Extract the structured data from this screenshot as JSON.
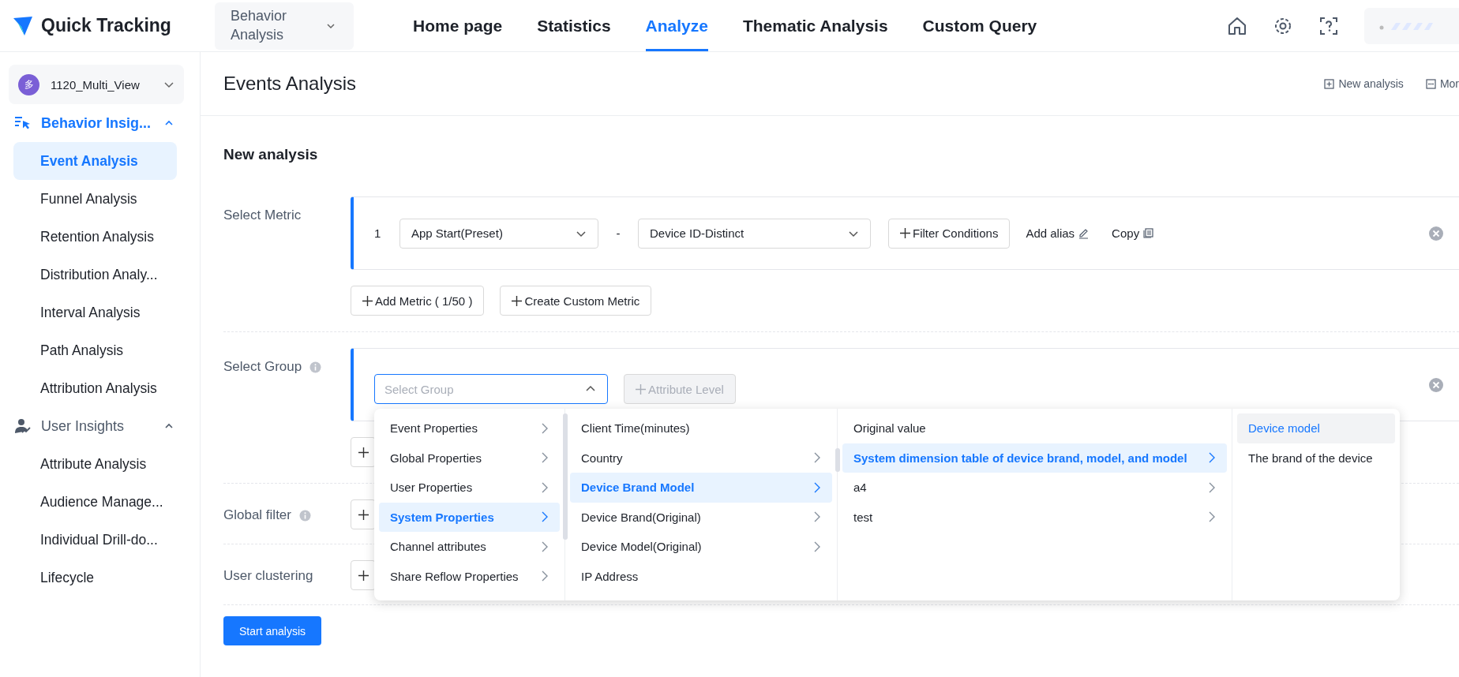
{
  "header": {
    "logo_text": "Quick Tracking",
    "product_select": "Behavior Analysis",
    "nav": [
      {
        "label": "Home page",
        "selected": false
      },
      {
        "label": "Statistics",
        "selected": false
      },
      {
        "label": "Analyze",
        "selected": true
      },
      {
        "label": "Thematic Analysis",
        "selected": false
      },
      {
        "label": "Custom Query",
        "selected": false
      }
    ]
  },
  "sidebar": {
    "workspace": {
      "avatar": "多",
      "name": "1120_Multi_View"
    },
    "groups": [
      {
        "label": "Behavior Insig...",
        "kind": "behavior",
        "selected": true,
        "expanded": true,
        "items": [
          {
            "label": "Event Analysis",
            "selected": true
          },
          {
            "label": "Funnel Analysis",
            "selected": false
          },
          {
            "label": "Retention Analysis",
            "selected": false
          },
          {
            "label": "Distribution Analy...",
            "selected": false
          },
          {
            "label": "Interval Analysis",
            "selected": false
          },
          {
            "label": "Path Analysis",
            "selected": false
          },
          {
            "label": "Attribution Analysis",
            "selected": false
          }
        ]
      },
      {
        "label": "User Insights",
        "kind": "user",
        "selected": false,
        "expanded": true,
        "items": [
          {
            "label": "Attribute Analysis",
            "selected": false
          },
          {
            "label": "Audience Manage...",
            "selected": false
          },
          {
            "label": "Individual Drill-do...",
            "selected": false
          },
          {
            "label": "Lifecycle",
            "selected": false
          }
        ]
      }
    ]
  },
  "page": {
    "title": "Events Analysis",
    "actions": [
      {
        "kind": "new",
        "label": "New analysis"
      },
      {
        "kind": "more",
        "label": "Mor"
      }
    ],
    "section_title": "New analysis",
    "metric": {
      "label": "Select Metric",
      "rows": [
        {
          "index": "1",
          "event": "App Start(Preset)",
          "separator": "-",
          "measure": "Device ID-Distinct",
          "filter_button": "Filter Conditions",
          "alias_button": "Add alias",
          "copy_button": "Copy"
        }
      ],
      "buttons": [
        "Add Metric ( 1/50 )",
        "Create Custom Metric"
      ]
    },
    "group": {
      "label": "Select Group",
      "select": {
        "placeholder": "Select Group",
        "expanded": true
      },
      "level_button": {
        "label": "Attribute Level",
        "disabled": true
      }
    },
    "dropdown": {
      "columns": [
        {
          "kind": "branch",
          "scrollbar": true,
          "items": [
            {
              "label": "Event Properties",
              "has_arrow": true,
              "selected": false
            },
            {
              "label": "Global Properties",
              "has_arrow": true,
              "selected": false
            },
            {
              "label": "User Properties",
              "has_arrow": true,
              "selected": false
            },
            {
              "label": "System Properties",
              "has_arrow": true,
              "selected": true
            },
            {
              "label": "Channel attributes",
              "has_arrow": true,
              "selected": false
            },
            {
              "label": "Share Reflow Properties",
              "has_arrow": true,
              "selected": false
            }
          ]
        },
        {
          "kind": "branch",
          "scrollbar": true,
          "items": [
            {
              "label": "Client Time(minutes)",
              "has_arrow": false,
              "selected": false
            },
            {
              "label": "Country",
              "has_arrow": true,
              "selected": false
            },
            {
              "label": "Device Brand Model",
              "has_arrow": true,
              "selected": true
            },
            {
              "label": "Device Brand(Original)",
              "has_arrow": true,
              "selected": false
            },
            {
              "label": "Device Model(Original)",
              "has_arrow": true,
              "selected": false
            },
            {
              "label": "IP Address",
              "has_arrow": false,
              "selected": false
            }
          ]
        },
        {
          "kind": "branch",
          "scrollbar": false,
          "items": [
            {
              "label": "Original value",
              "has_arrow": false,
              "selected": false
            },
            {
              "label": "System dimension table of device brand, model, and model",
              "has_arrow": true,
              "selected": true
            },
            {
              "label": "a4",
              "has_arrow": true,
              "selected": false
            },
            {
              "label": "test",
              "has_arrow": true,
              "selected": false
            }
          ]
        },
        {
          "kind": "leaf",
          "scrollbar": false,
          "items": [
            {
              "label": "Device model",
              "has_arrow": false,
              "selected": true
            },
            {
              "label": "The brand of the device",
              "has_arrow": false,
              "selected": false
            }
          ]
        }
      ]
    },
    "global_filter": {
      "label": "Global filter"
    },
    "user_clustering": {
      "label": "User clustering"
    },
    "start_button": "Start analysis"
  }
}
